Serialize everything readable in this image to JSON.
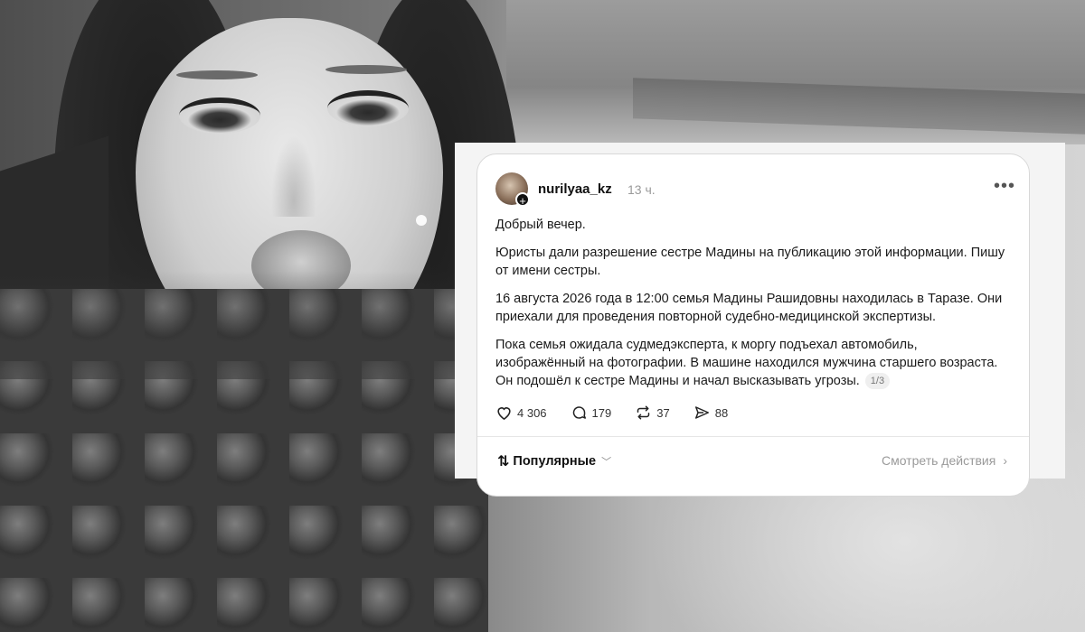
{
  "post": {
    "username": "nurilyaa_kz",
    "time": "13 ч.",
    "paragraphs": [
      "Добрый вечер.",
      "Юристы дали разрешение сестре Мадины на публикацию этой информации. Пишу от имени сестры.",
      "16 августа 2026 года в 12:00 семья Мадины Рашидовны находилась в Таразе. Они приехали для проведения повторной судебно-медицинской экспертизы.",
      "Пока семья ожидала судмедэксперта, к моргу подъехал автомобиль, изображённый на фотографии. В машине находился мужчина старшего возраста. Он подошёл к сестре Мадины и начал высказывать угрозы."
    ],
    "page_indicator": "1/3",
    "stats": {
      "likes": "4 306",
      "comments": "179",
      "reposts": "37",
      "shares": "88"
    }
  },
  "footer": {
    "sort_label": "Популярные",
    "view_activity": "Смотреть действия"
  },
  "icons": {
    "more": "more-horizontal-icon",
    "like": "heart-icon",
    "comment": "comment-icon",
    "repost": "repost-icon",
    "share": "send-icon",
    "sort": "sort-arrows-icon"
  }
}
